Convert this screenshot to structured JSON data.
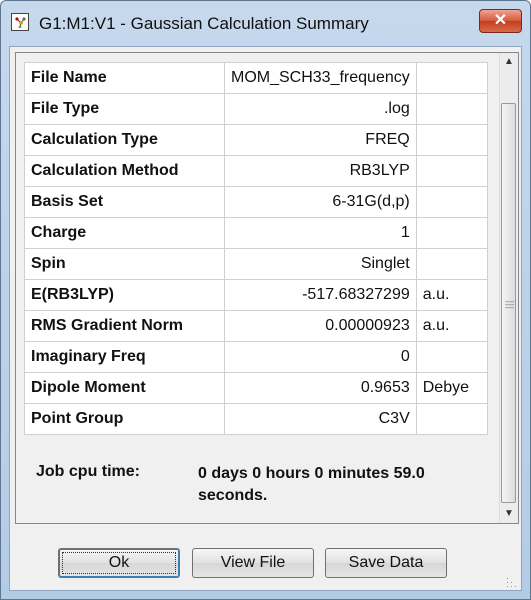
{
  "window": {
    "title": "G1:M1:V1 - Gaussian Calculation Summary",
    "close_glyph": "✕"
  },
  "summary": {
    "rows": [
      {
        "label": "File Name",
        "value": "MOM_SCH33_frequency",
        "unit": ""
      },
      {
        "label": "File Type",
        "value": ".log",
        "unit": ""
      },
      {
        "label": "Calculation Type",
        "value": "FREQ",
        "unit": ""
      },
      {
        "label": "Calculation Method",
        "value": "RB3LYP",
        "unit": ""
      },
      {
        "label": "Basis Set",
        "value": "6-31G(d,p)",
        "unit": ""
      },
      {
        "label": "Charge",
        "value": "1",
        "unit": ""
      },
      {
        "label": "Spin",
        "value": "Singlet",
        "unit": ""
      },
      {
        "label": "E(RB3LYP)",
        "value": "-517.68327299",
        "unit": "a.u."
      },
      {
        "label": "RMS Gradient Norm",
        "value": "0.00000923",
        "unit": "a.u."
      },
      {
        "label": "Imaginary Freq",
        "value": "0",
        "unit": ""
      },
      {
        "label": "Dipole Moment",
        "value": "0.9653",
        "unit": "Debye"
      },
      {
        "label": "Point Group",
        "value": "C3V",
        "unit": ""
      }
    ],
    "job_cpu_time": {
      "label": "Job cpu time:",
      "value": "0 days  0 hours  0 minutes  59.0 seconds."
    }
  },
  "buttons": {
    "ok": "Ok",
    "view_file": "View File",
    "save_data": "Save Data"
  },
  "icons": {
    "scroll_up": "▲",
    "scroll_down": "▼"
  },
  "colors": {
    "title_bar": "#b9d1ea",
    "close_button": "#c94a2c",
    "grid_lines": "#d0d0d0"
  }
}
